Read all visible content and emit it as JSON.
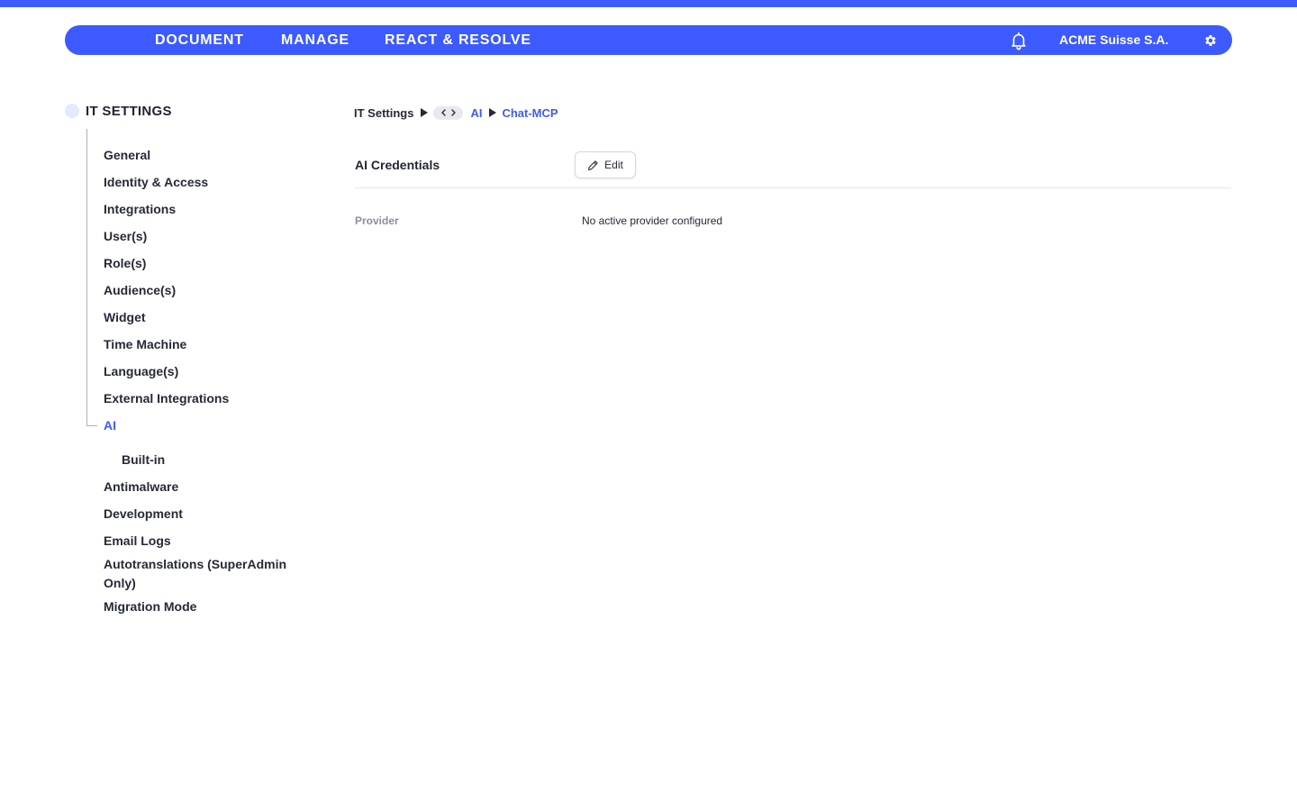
{
  "nav": {
    "items": [
      "DOCUMENT",
      "MANAGE",
      "REACT & RESOLVE"
    ],
    "organization": "ACME Suisse S.A.",
    "accent_color": "#3d5afe",
    "icons": [
      "bell-icon",
      "gear-icon"
    ]
  },
  "sidebar": {
    "title": "IT SETTINGS",
    "items": [
      "General",
      "Identity & Access",
      "Integrations",
      "User(s)",
      "Role(s)",
      "Audience(s)",
      "Widget",
      "Time Machine",
      "Language(s)",
      "External Integrations",
      "AI",
      "Built-in",
      "Antimalware",
      "Development",
      "Email Logs",
      "Autotranslations (SuperAdmin Only)",
      "Migration Mode"
    ],
    "active_item": "AI"
  },
  "breadcrumb": {
    "root": "IT Settings",
    "parent": "AI",
    "current": "Chat-MCP"
  },
  "section": {
    "title": "AI Credentials",
    "edit_label": "Edit",
    "fields": [
      {
        "label": "Provider",
        "value": "No active provider configured"
      }
    ]
  }
}
